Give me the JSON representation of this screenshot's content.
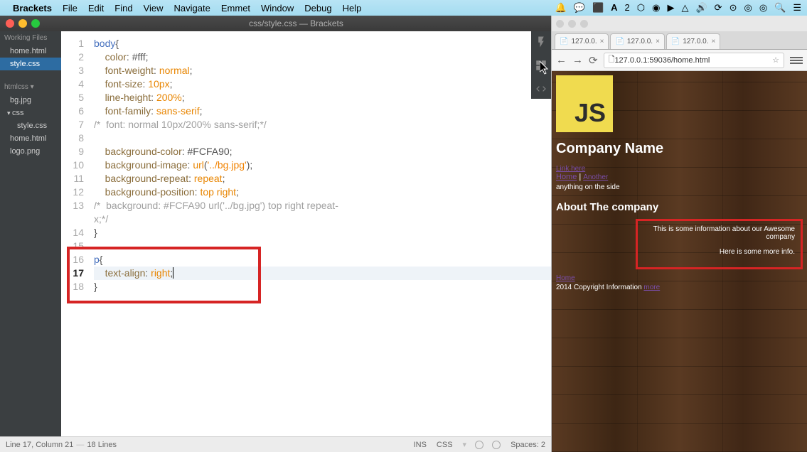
{
  "menubar": {
    "app_name": "Brackets",
    "items": [
      "File",
      "Edit",
      "Find",
      "View",
      "Navigate",
      "Emmet",
      "Window",
      "Debug",
      "Help"
    ],
    "tray_icons": [
      "notification",
      "chat",
      "search",
      "folder",
      "adobe",
      "number2",
      "dropbox",
      "circle",
      "play",
      "drive",
      "volume",
      "shuffle",
      "sync",
      "wifi",
      "target",
      "search2",
      "list"
    ]
  },
  "brackets": {
    "window_title": "css/style.css — Brackets",
    "sidebar": {
      "working_files_label": "Working Files",
      "working_files": [
        {
          "name": "home.html",
          "active": false
        },
        {
          "name": "style.css",
          "active": true
        }
      ],
      "project_label": "htmlcss ▾",
      "tree": [
        {
          "name": "bg.jpg",
          "type": "file",
          "indent": 0
        },
        {
          "name": "css",
          "type": "folder",
          "indent": 0
        },
        {
          "name": "style.css",
          "type": "file",
          "indent": 1
        },
        {
          "name": "home.html",
          "type": "file",
          "indent": 0
        },
        {
          "name": "logo.png",
          "type": "file",
          "indent": 0
        }
      ]
    },
    "code_lines": [
      {
        "n": 1,
        "tokens": [
          {
            "t": "body",
            "c": "kw"
          },
          {
            "t": "{",
            "c": "punct"
          }
        ]
      },
      {
        "n": 2,
        "tokens": [
          {
            "t": "    ",
            "c": ""
          },
          {
            "t": "color",
            "c": "prop"
          },
          {
            "t": ": ",
            "c": "punct"
          },
          {
            "t": "#fff",
            "c": "hex"
          },
          {
            "t": ";",
            "c": "punct"
          }
        ]
      },
      {
        "n": 3,
        "tokens": [
          {
            "t": "    ",
            "c": ""
          },
          {
            "t": "font-weight",
            "c": "prop"
          },
          {
            "t": ": ",
            "c": "punct"
          },
          {
            "t": "normal",
            "c": "val"
          },
          {
            "t": ";",
            "c": "punct"
          }
        ]
      },
      {
        "n": 4,
        "tokens": [
          {
            "t": "    ",
            "c": ""
          },
          {
            "t": "font-size",
            "c": "prop"
          },
          {
            "t": ": ",
            "c": "punct"
          },
          {
            "t": "10px",
            "c": "val"
          },
          {
            "t": ";",
            "c": "punct"
          }
        ]
      },
      {
        "n": 5,
        "tokens": [
          {
            "t": "    ",
            "c": ""
          },
          {
            "t": "line-height",
            "c": "prop"
          },
          {
            "t": ": ",
            "c": "punct"
          },
          {
            "t": "200%",
            "c": "val"
          },
          {
            "t": ";",
            "c": "punct"
          }
        ]
      },
      {
        "n": 6,
        "tokens": [
          {
            "t": "    ",
            "c": ""
          },
          {
            "t": "font-family",
            "c": "prop"
          },
          {
            "t": ": ",
            "c": "punct"
          },
          {
            "t": "sans-serif",
            "c": "val"
          },
          {
            "t": ";",
            "c": "punct"
          }
        ]
      },
      {
        "n": 7,
        "tokens": [
          {
            "t": "/*  font: normal 10px/200% sans-serif;*/",
            "c": "cmt"
          }
        ]
      },
      {
        "n": 8,
        "tokens": [
          {
            "t": "",
            "c": ""
          }
        ]
      },
      {
        "n": 9,
        "tokens": [
          {
            "t": "    ",
            "c": ""
          },
          {
            "t": "background-color",
            "c": "prop"
          },
          {
            "t": ": ",
            "c": "punct"
          },
          {
            "t": "#FCFA90",
            "c": "hex"
          },
          {
            "t": ";",
            "c": "punct"
          }
        ]
      },
      {
        "n": 10,
        "tokens": [
          {
            "t": "    ",
            "c": ""
          },
          {
            "t": "background-image",
            "c": "prop"
          },
          {
            "t": ": ",
            "c": "punct"
          },
          {
            "t": "url",
            "c": "val"
          },
          {
            "t": "(",
            "c": "punct"
          },
          {
            "t": "'../bg.jpg'",
            "c": "str"
          },
          {
            "t": ")",
            "c": "punct"
          },
          {
            "t": ";",
            "c": "punct"
          }
        ]
      },
      {
        "n": 11,
        "tokens": [
          {
            "t": "    ",
            "c": ""
          },
          {
            "t": "background-repeat",
            "c": "prop"
          },
          {
            "t": ": ",
            "c": "punct"
          },
          {
            "t": "repeat",
            "c": "val"
          },
          {
            "t": ";",
            "c": "punct"
          }
        ]
      },
      {
        "n": 12,
        "tokens": [
          {
            "t": "    ",
            "c": ""
          },
          {
            "t": "background-position",
            "c": "prop"
          },
          {
            "t": ": ",
            "c": "punct"
          },
          {
            "t": "top",
            "c": "val"
          },
          {
            "t": " ",
            "c": ""
          },
          {
            "t": "right",
            "c": "val"
          },
          {
            "t": ";",
            "c": "punct"
          }
        ]
      },
      {
        "n": 13,
        "tokens": [
          {
            "t": "/*  background: #FCFA90 url('../bg.jpg') top right repeat-",
            "c": "cmt"
          }
        ]
      },
      {
        "n": "",
        "tokens": [
          {
            "t": "x;*/",
            "c": "cmt"
          }
        ]
      },
      {
        "n": 14,
        "tokens": [
          {
            "t": "}",
            "c": "punct"
          }
        ]
      },
      {
        "n": 15,
        "tokens": [
          {
            "t": "",
            "c": ""
          }
        ]
      },
      {
        "n": 16,
        "tokens": [
          {
            "t": "p",
            "c": "kw"
          },
          {
            "t": "{",
            "c": "punct"
          }
        ]
      },
      {
        "n": 17,
        "tokens": [
          {
            "t": "    ",
            "c": ""
          },
          {
            "t": "text-align",
            "c": "prop"
          },
          {
            "t": ": ",
            "c": "punct"
          },
          {
            "t": "right",
            "c": "val"
          },
          {
            "t": ";",
            "c": "punct"
          }
        ],
        "active": true
      },
      {
        "n": 18,
        "tokens": [
          {
            "t": "}",
            "c": "punct"
          }
        ]
      }
    ],
    "statusbar": {
      "position": "Line 17, Column 21",
      "linecount": "18 Lines",
      "ins": "INS",
      "lang": "CSS",
      "spaces": "Spaces: 2"
    }
  },
  "chrome": {
    "tabs": [
      {
        "label": "127.0.0."
      },
      {
        "label": "127.0.0."
      },
      {
        "label": "127.0.0."
      }
    ],
    "url": "127.0.0.1:59036/home.html",
    "page": {
      "js_logo_text": "JS",
      "company_name": "Company Name",
      "nav_link1": "Link here",
      "nav_link2": "Another",
      "sideline": "anything on the side",
      "about_heading": "About The company",
      "info_p1": "This is some information about our Awesome company",
      "info_p2": "Here is some more info.",
      "footer_small": "Home",
      "footer_copy": "2014 Copyright Information",
      "footer_more": "more"
    }
  }
}
